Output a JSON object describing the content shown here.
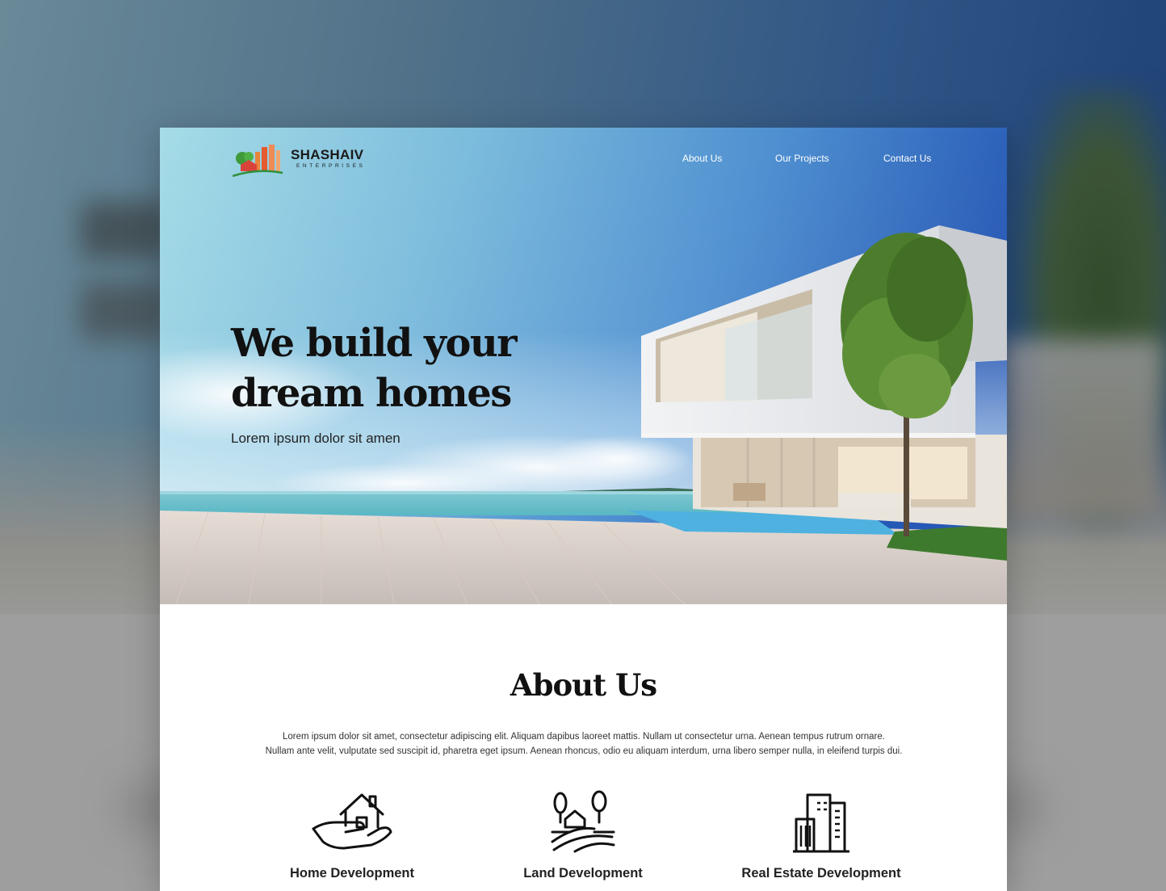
{
  "brand": {
    "name": "SHASHAIV",
    "tagline": "ENTERPRISES"
  },
  "nav": {
    "items": [
      {
        "label": "About Us"
      },
      {
        "label": "Our Projects"
      },
      {
        "label": "Contact Us"
      }
    ]
  },
  "hero": {
    "title": "We build your dream homes",
    "subtitle": "Lorem ipsum dolor sit amen"
  },
  "about": {
    "title": "About Us",
    "paragraph_line1": "Lorem ipsum dolor sit amet, consectetur adipiscing elit. Aliquam dapibus laoreet mattis. Nullam ut consectetur urna. Aenean tempus rutrum ornare.",
    "paragraph_line2": "Nullam ante velit, vulputate sed suscipit id, pharetra eget ipsum. Aenean rhoncus, odio eu aliquam interdum, urna libero semper nulla, in eleifend turpis dui.",
    "features": [
      {
        "label": "Home Development",
        "icon": "hand-house-icon"
      },
      {
        "label": "Land Development",
        "icon": "farm-land-icon"
      },
      {
        "label": "Real Estate Development",
        "icon": "buildings-icon"
      }
    ]
  },
  "colors": {
    "sky_top": "#2b63b8",
    "sky_light": "#a8dbe6",
    "heading": "#111111",
    "nav_text": "#ffffff"
  }
}
